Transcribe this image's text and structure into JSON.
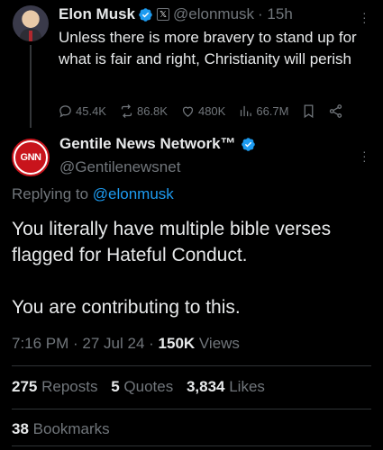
{
  "parent_tweet": {
    "name": "Elon Musk",
    "handle": "@elonmusk",
    "time": "· 15h",
    "text": "Unless there is more bravery to stand up for what is fair and right, Christianity will perish",
    "actions": {
      "replies": "45.4K",
      "reposts": "86.8K",
      "likes": "480K",
      "views": "66.7M"
    }
  },
  "quote_tweet": {
    "name": "Gentile News Network™",
    "handle": "@Gentilenewsnet",
    "avatar_text": "GNN",
    "replying_prefix": "Replying to ",
    "replying_to": "@elonmusk",
    "text_line1": "You literally have multiple bible verses flagged for Hateful Conduct.",
    "text_line2": "You are contributing to this.",
    "time": "7:16 PM · 27 Jul 24 · ",
    "views_count": "150K",
    "views_label": " Views",
    "stats": {
      "reposts_count": "275",
      "reposts_label": " Reposts",
      "quotes_count": "5",
      "quotes_label": " Quotes",
      "likes_count": "3,834",
      "likes_label": " Likes",
      "bookmarks_count": "38",
      "bookmarks_label": " Bookmarks"
    }
  },
  "colors": {
    "background": "#000000",
    "text": "#e7e9ea",
    "muted": "#71767b",
    "accent": "#1d9bf0",
    "divider": "#2f3336",
    "gnn_red": "#c8141c"
  }
}
